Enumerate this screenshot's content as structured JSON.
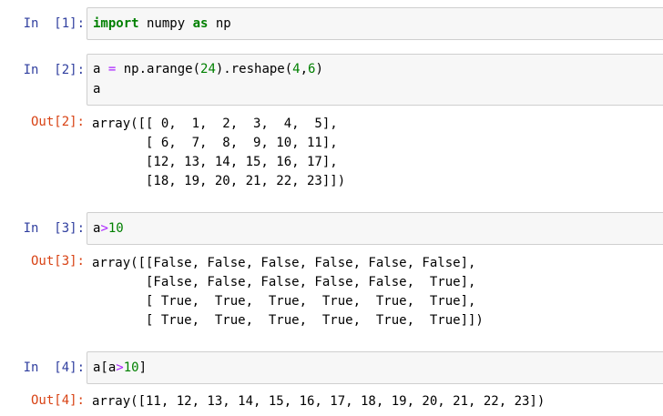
{
  "cells": [
    {
      "in_prompt": "In  [1]:",
      "code_tokens": [
        [
          [
            "kw",
            "import"
          ],
          [
            "plain",
            " numpy "
          ],
          [
            "kw",
            "as"
          ],
          [
            "plain",
            " np"
          ]
        ]
      ]
    },
    {
      "in_prompt": "In  [2]:",
      "code_tokens": [
        [
          [
            "plain",
            "a "
          ],
          [
            "op",
            "="
          ],
          [
            "plain",
            " np.arange("
          ],
          [
            "num",
            "24"
          ],
          [
            "plain",
            ").reshape("
          ],
          [
            "num",
            "4"
          ],
          [
            "plain",
            ","
          ],
          [
            "num",
            "6"
          ],
          [
            "plain",
            ")"
          ]
        ],
        [
          [
            "plain",
            "a"
          ]
        ]
      ],
      "out_prompt": "Out[2]:",
      "output_lines": [
        "array([[ 0,  1,  2,  3,  4,  5],",
        "       [ 6,  7,  8,  9, 10, 11],",
        "       [12, 13, 14, 15, 16, 17],",
        "       [18, 19, 20, 21, 22, 23]])"
      ]
    },
    {
      "in_prompt": "In  [3]:",
      "code_tokens": [
        [
          [
            "plain",
            "a"
          ],
          [
            "op",
            ">"
          ],
          [
            "num",
            "10"
          ]
        ]
      ],
      "out_prompt": "Out[3]:",
      "output_lines": [
        "array([[False, False, False, False, False, False],",
        "       [False, False, False, False, False,  True],",
        "       [ True,  True,  True,  True,  True,  True],",
        "       [ True,  True,  True,  True,  True,  True]])"
      ]
    },
    {
      "in_prompt": "In  [4]:",
      "code_tokens": [
        [
          [
            "plain",
            "a["
          ],
          [
            "plain",
            "a"
          ],
          [
            "op",
            ">"
          ],
          [
            "num",
            "10"
          ],
          [
            "plain",
            "]"
          ]
        ]
      ],
      "out_prompt": "Out[4]:",
      "output_lines": [
        "array([11, 12, 13, 14, 15, 16, 17, 18, 19, 20, 21, 22, 23])"
      ]
    }
  ]
}
